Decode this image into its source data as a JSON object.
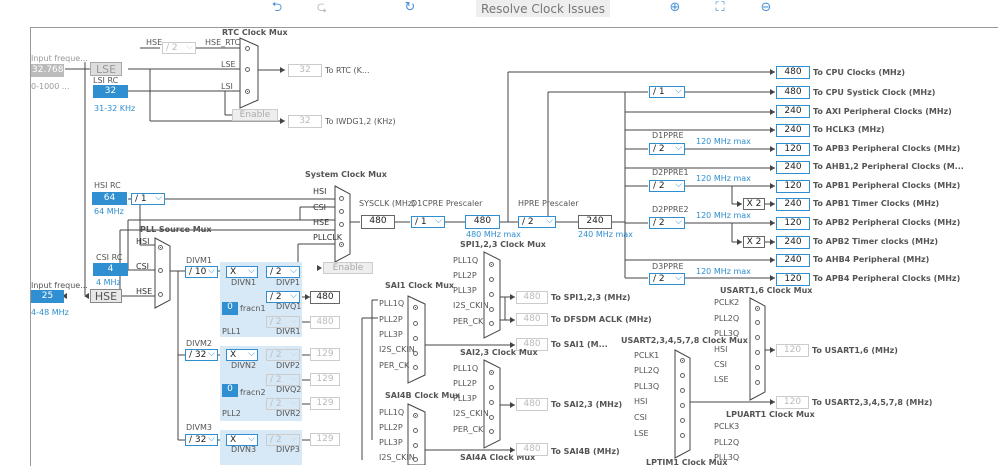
{
  "toolbar": {
    "undo_icon": "undo-icon",
    "redo_icon": "redo-icon",
    "refresh_icon": "refresh-icon",
    "resolve_label": "Resolve Clock Issues",
    "zoom_in_icon": "zoom-in-icon",
    "fit_icon": "fit-screen-icon",
    "zoom_out_icon": "zoom-out-icon"
  },
  "inputs": {
    "lse_input_label": "Input freque...",
    "lse_value": "32.768",
    "lse_range": "0-1000 ...",
    "lse_label": "LSE",
    "lsi_label": "LSI RC",
    "lsi_value": "32",
    "lsi_range": "31-32 KHz",
    "hsi_label": "HSI RC",
    "hsi_value": "64",
    "hsi_freq": "64 MHz",
    "csi_label": "CSI RC",
    "csi_value": "4",
    "csi_freq": "4 MHz",
    "hse_input_label": "Input freque...",
    "hse_value": "25",
    "hse_range": "4-48 MHz",
    "hse_label": "HSE"
  },
  "rtc": {
    "title": "RTC Clock Mux",
    "hse_label": "HSE",
    "hse_rtc_label": "HSE_RTC",
    "div": "/ 2",
    "lse": "LSE",
    "lsi": "LSI",
    "rtc_value": "32",
    "rtc_label": "To RTC (K...",
    "enable": "Enable",
    "iwdg_value": "32",
    "iwdg_label": "To IWDG1,2 (KHz)"
  },
  "sysmux": {
    "title": "System Clock Mux",
    "hsi": "HSI",
    "csi": "CSI",
    "hse": "HSE",
    "pllclk": "PLLCLK",
    "enable": "Enable",
    "sysclk_label": "SYSCLK (MHz)",
    "sysclk_value": "480",
    "d1cpre_label": "D1CPRE Prescaler",
    "d1cpre_div": "/ 1",
    "d1cpre_value": "480",
    "d1cpre_max": "480 MHz max",
    "hpre_label": "HPRE Prescaler",
    "hpre_div": "/ 2",
    "hpre_value": "240",
    "hpre_max": "240 MHz max"
  },
  "outputs": [
    {
      "value": "480",
      "label": "To CPU Clocks (MHz)"
    },
    {
      "value": "480",
      "label": "To CPU Systick Clock (MHz)"
    },
    {
      "value": "240",
      "label": "To AXI Peripheral Clocks (MHz)"
    },
    {
      "value": "240",
      "label": "To HCLK3 (MHz)"
    },
    {
      "value": "120",
      "label": "To APB3 Peripheral Clocks (MHz)"
    },
    {
      "value": "240",
      "label": "To AHB1,2 Peripheral Clocks (M..."
    },
    {
      "value": "120",
      "label": "To APB1 Peripheral Clocks (MHz)"
    },
    {
      "value": "240",
      "label": "To APB1 Timer Clocks (MHz)"
    },
    {
      "value": "120",
      "label": "To APB2 Peripheral Clocks (MHz)"
    },
    {
      "value": "240",
      "label": "To APB2 Timer clocks (MHz)"
    },
    {
      "value": "240",
      "label": "To AHB4 Peripheral (MHz)"
    },
    {
      "value": "120",
      "label": "To APB4 Peripheral Clocks (MHz)"
    }
  ],
  "prescalers": {
    "systick_div": "/ 1",
    "d1ppre_label": "D1PPRE",
    "d1ppre_div": "/ 2",
    "d1ppre_max": "120 MHz max",
    "d2ppre1_label": "D2PPRE1",
    "d2ppre1_div": "/ 2",
    "d2ppre1_max": "120 MHz max",
    "x2a": "X 2",
    "d2ppre2_label": "D2PPRE2",
    "d2ppre2_div": "/ 2",
    "d2ppre2_max": "120 MHz max",
    "x2b": "X 2",
    "d3ppre_label": "D3PPRE",
    "d3ppre_div": "/ 2",
    "d3ppre_max": "120 MHz max"
  },
  "pll": {
    "source_title": "PLL Source Mux",
    "hsi": "HSI",
    "csi": "CSI",
    "hse": "HSE",
    "divm1_label": "DIVM1",
    "divm1": "/ 10",
    "divn1_sel": "X",
    "divn1": "DIVN1",
    "divp1_sel": "/ 2",
    "divp1": "DIVP1",
    "divq1_sel": "/ 2",
    "divq1": "DIVQ1",
    "divr1_sel": "/ 2",
    "divr1": "DIVR1",
    "fracn1_value": "0",
    "fracn1": "fracn1",
    "pll1_label": "PLL1",
    "pll1_p_value": "480",
    "pll1_r_value": "480",
    "divm2_label": "DIVM2",
    "divm2": "/ 32",
    "divn2_sel": "X",
    "divn2": "DIVN2",
    "divp2_sel": "/ 2",
    "divp2": "DIVP2",
    "divq2_sel": "/ 2",
    "divq2": "DIVQ2",
    "divr2_sel": "/ 2",
    "divr2": "DIVR2",
    "fracn2_value": "0",
    "fracn2": "fracn2",
    "pll2_label": "PLL2",
    "pll2_p_value": "129",
    "pll2_q_value": "129",
    "pll2_r_value": "129",
    "divm3_label": "DIVM3",
    "divm3": "/ 32",
    "divn3_sel": "X",
    "divn3": "DIVN3",
    "divp3_sel": "/ 2",
    "divp3": "DIVP3",
    "pll3_p_value": "129"
  },
  "spi123": {
    "title": "SPI1,2,3 Clock Mux",
    "pll1q": "PLL1Q",
    "pll2p": "PLL2P",
    "pll3p": "PLL3P",
    "i2s": "I2S_CKIN",
    "per": "PER_CK",
    "value": "480",
    "label": "To SPI1,2,3 (MHz)",
    "dfsdm_value": "480",
    "dfsdm_label": "To DFSDM ACLK (MHz)"
  },
  "sai1": {
    "title": "SAI1 Clock Mux",
    "pll1q": "PLL1Q",
    "pll2p": "PLL2P",
    "pll3p": "PLL3P",
    "i2s": "I2S_CKIN",
    "per": "PER_CK",
    "value": "480",
    "label": "To SAI1 (M..."
  },
  "sai23": {
    "title": "SAI2,3 Clock Mux",
    "pll1q": "PLL1Q",
    "pll2p": "PLL2P",
    "pll3p": "PLL3P",
    "i2s": "I2S_CKIN",
    "per": "PER_CK",
    "value": "480",
    "label": "To SAI2,3 (MHz)"
  },
  "sai4b": {
    "title": "SAI4B Clock Mux",
    "pll1q": "PLL1Q",
    "pll2p": "PLL2P",
    "pll3p": "PLL3P",
    "i2s": "I2S_CKIN"
  },
  "sai4a": {
    "title": "SAI4A Clock Mux",
    "value": "480",
    "label": "To SAI4B (MHz)"
  },
  "usart16": {
    "title": "USART1,6 Clock Mux",
    "pclk2": "PCLK2",
    "pll2q": "PLL2Q",
    "pll3q": "PLL3Q",
    "hsi": "HSI",
    "csi": "CSI",
    "lse": "LSE",
    "value": "120",
    "label": "To USART1,6 (MHz)"
  },
  "usart2": {
    "title": "USART2,3,4,5,7,8 Clock Mux",
    "pclk1": "PCLK1",
    "pll2q": "PLL2Q",
    "pll3q": "PLL3Q",
    "hsi": "HSI",
    "csi": "CSI",
    "lse": "LSE",
    "value": "120",
    "label": "To USART2,3,4,5,7,8 (MHz)"
  },
  "lpuart1": {
    "title": "LPUART1 Clock Mux",
    "pclk3": "PCLK3",
    "pll2q": "PLL2Q",
    "pll3q": "PLL3Q"
  },
  "lptim1": {
    "title": "LPTIM1 Clock Mux"
  }
}
